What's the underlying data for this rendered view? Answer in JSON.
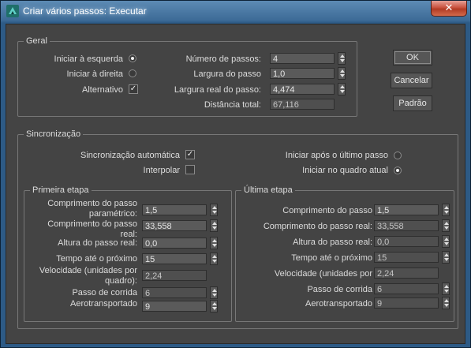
{
  "window": {
    "title": "Criar vários passos: Executar",
    "close_label": "✕"
  },
  "geral": {
    "title": "Geral",
    "start_left": "Iniciar à esquerda",
    "start_right": "Iniciar à direita",
    "alternate": "Alternativo",
    "num_steps_label": "Número de passos:",
    "num_steps_value": "4",
    "step_width_label": "Largura do passo",
    "step_width_value": "1,0",
    "real_width_label": "Largura real do passo:",
    "real_width_value": "4,474",
    "total_distance_label": "Distância total:",
    "total_distance_value": "67,116"
  },
  "buttons": {
    "ok": "OK",
    "cancel": "Cancelar",
    "default": "Padrão"
  },
  "sync": {
    "title": "Sincronização",
    "auto_sync": "Sincronização automática",
    "interpolate": "Interpolar",
    "start_after_last": "Iniciar após o último passo",
    "start_current_frame": "Iniciar no quadro atual"
  },
  "first_stage": {
    "title": "Primeira etapa",
    "param_length_label": "Comprimento do passo paramétrico:",
    "param_length_value": "1,5",
    "real_length_label": "Comprimento do passo real:",
    "real_length_value": "33,558",
    "real_height_label": "Altura do passo real:",
    "real_height_value": "0,0",
    "time_next_label": "Tempo até o próximo",
    "time_next_value": "15",
    "speed_label": "Velocidade (unidades por quadro):",
    "speed_value": "2,24",
    "run_step_label": "Passo de corrida",
    "run_step_value": "6",
    "airborne_label": "Aerotransportado",
    "airborne_value": "9"
  },
  "last_stage": {
    "title": "Última etapa",
    "length_label": "Comprimento do passo",
    "length_value": "1,5",
    "real_length_label": "Comprimento do passo real:",
    "real_length_value": "33,558",
    "real_height_label": "Altura do passo real:",
    "real_height_value": "0,0",
    "time_next_label": "Tempo até o próximo",
    "time_next_value": "15",
    "speed_label": "Velocidade (unidades por",
    "speed_value": "2,24",
    "run_step_label": "Passo de corrida",
    "run_step_value": "6",
    "airborne_label": "Aerotransportado",
    "airborne_value": "9"
  }
}
